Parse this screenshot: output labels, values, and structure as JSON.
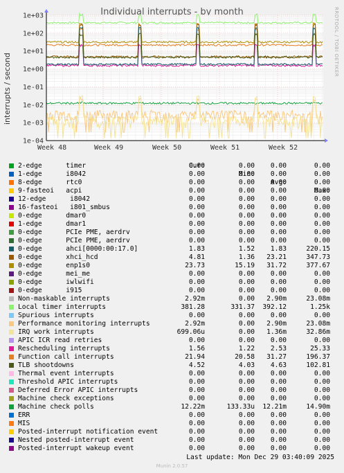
{
  "title": "Individual interrupts - by month",
  "side_label": "RRDTOOL / TOBI OETIKER",
  "chart_data": {
    "type": "line",
    "title": "Individual interrupts - by month",
    "ylabel": "interrupts / second",
    "yscale": "log",
    "ylim": [
      0.0001,
      1000
    ],
    "y_ticks": [
      "1e+03",
      "1e+02",
      "1e+01",
      "1e+00",
      "1e-01",
      "1e-02",
      "1e-03",
      "1e-04"
    ],
    "x_ticks": [
      "Week 48",
      "Week 49",
      "Week 50",
      "Week 51",
      "Week 52"
    ],
    "grid": true,
    "series": [
      {
        "name": "Local timer interrupts",
        "color": "#8ef26e",
        "base": 381.28,
        "spike": 1250
      },
      {
        "name": "Function call interrupts",
        "color": "#e67e22",
        "base": 21.94,
        "spike": 196.37
      },
      {
        "name": "0-edge enp1s0",
        "color": "#b08c00",
        "base": 31.72,
        "spike": 377.67
      },
      {
        "name": "Rescheduling interrupts",
        "color": "#e0189a",
        "base": 1.56,
        "spike": 25.33
      },
      {
        "name": "0-edge xhci_hcd",
        "color": "#9c5a00",
        "base": 4.81,
        "spike": 347.73
      },
      {
        "name": "0-edge ahci[0000:00:17.0]",
        "color": "#175e6c",
        "base": 1.83,
        "spike": 220.15
      },
      {
        "name": "TLB shootdowns",
        "color": "#4a5a18",
        "base": 4.52,
        "spike": 102.81
      },
      {
        "name": "Machine check polls",
        "color": "#10a03c",
        "base": 0.0122,
        "spike": 0.0149
      },
      {
        "name": "Performance monitoring interrupts",
        "color": "#f9c882",
        "base": 0.0029,
        "spike": 0.0231
      },
      {
        "name": "IRQ work interrupts",
        "color": "#f4e39a",
        "base": 0.0014,
        "spike": 0.0329
      }
    ]
  },
  "legend": {
    "headers": [
      "Cur:",
      "Min:",
      "Avg:",
      "Max:"
    ],
    "rows": [
      {
        "name": "2-edge      timer",
        "color": "#00a020",
        "cur": "0.00",
        "min": "0.00",
        "avg": "0.00",
        "max": "0.00"
      },
      {
        "name": "1-edge      i8042",
        "color": "#0060c0",
        "cur": "0.00",
        "min": "0.00",
        "avg": "0.00",
        "max": "0.00"
      },
      {
        "name": "8-edge      rtc0",
        "color": "#ff7000",
        "cur": "0.00",
        "min": "0.00",
        "avg": "0.00",
        "max": "0.00"
      },
      {
        "name": "9-fasteoi   acpi",
        "color": "#ffc800",
        "cur": "0.00",
        "min": "0.00",
        "avg": "0.00",
        "max": "0.00"
      },
      {
        "name": "12-edge      i8042",
        "color": "#200090",
        "cur": "0.00",
        "min": "0.00",
        "avg": "0.00",
        "max": "0.00"
      },
      {
        "name": "16-fasteoi   i801_smbus",
        "color": "#900090",
        "cur": "0.00",
        "min": "0.00",
        "avg": "0.00",
        "max": "0.00"
      },
      {
        "name": "0-edge      dmar0",
        "color": "#c8e600",
        "cur": "0.00",
        "min": "0.00",
        "avg": "0.00",
        "max": "0.00"
      },
      {
        "name": "1-edge      dmar1",
        "color": "#e00000",
        "cur": "0.00",
        "min": "0.00",
        "avg": "0.00",
        "max": "0.00"
      },
      {
        "name": "0-edge      PCIe PME, aerdrv",
        "color": "#409c40",
        "cur": "0.00",
        "min": "0.00",
        "avg": "0.00",
        "max": "0.00"
      },
      {
        "name": "0-edge      PCIe PME, aerdrv",
        "color": "#2e6e30",
        "cur": "0.00",
        "min": "0.00",
        "avg": "0.00",
        "max": "0.00"
      },
      {
        "name": "0-edge      ahci[0000:00:17.0]",
        "color": "#175e6c",
        "cur": "1.83",
        "min": "1.52",
        "avg": "1.83",
        "max": "220.15"
      },
      {
        "name": "0-edge      xhci_hcd",
        "color": "#9c5a00",
        "cur": "4.81",
        "min": "1.36",
        "avg": "23.21",
        "max": "347.73"
      },
      {
        "name": "0-edge      enp1s0",
        "color": "#b08c00",
        "cur": "23.73",
        "min": "15.19",
        "avg": "31.72",
        "max": "377.67"
      },
      {
        "name": "0-edge      mei_me",
        "color": "#5c1a80",
        "cur": "0.00",
        "min": "0.00",
        "avg": "0.00",
        "max": "0.00"
      },
      {
        "name": "0-edge      iwlwifi",
        "color": "#8ca000",
        "cur": "0.00",
        "min": "0.00",
        "avg": "0.00",
        "max": "0.00"
      },
      {
        "name": "0-edge      i915",
        "color": "#a01414",
        "cur": "0.00",
        "min": "0.00",
        "avg": "0.00",
        "max": "0.00"
      },
      {
        "name": "Non-maskable interrupts",
        "color": "#bcbcbc",
        "cur": "2.92m",
        "min": "0.00",
        "avg": "2.90m",
        "max": "23.08m"
      },
      {
        "name": "Local timer interrupts",
        "color": "#8ef26e",
        "cur": "381.28",
        "min": "331.37",
        "avg": "392.12",
        "max": "1.25k"
      },
      {
        "name": "Spurious interrupts",
        "color": "#7ec8f8",
        "cur": "0.00",
        "min": "0.00",
        "avg": "0.00",
        "max": "0.00"
      },
      {
        "name": "Performance monitoring interrupts",
        "color": "#f9c882",
        "cur": "2.92m",
        "min": "0.00",
        "avg": "2.90m",
        "max": "23.08m"
      },
      {
        "name": "IRQ work interrupts",
        "color": "#f4e39a",
        "cur": "699.06u",
        "min": "0.00",
        "avg": "1.36m",
        "max": "32.86m"
      },
      {
        "name": "APIC ICR read retries",
        "color": "#b890ee",
        "cur": "0.00",
        "min": "0.00",
        "avg": "0.00",
        "max": "0.00"
      },
      {
        "name": "Rescheduling interrupts",
        "color": "#e0189a",
        "cur": "1.56",
        "min": "1.22",
        "avg": "2.53",
        "max": "25.33"
      },
      {
        "name": "Function call interrupts",
        "color": "#e67e22",
        "cur": "21.94",
        "min": "20.58",
        "avg": "31.27",
        "max": "196.37"
      },
      {
        "name": "TLB shootdowns",
        "color": "#4a5a18",
        "cur": "4.52",
        "min": "4.03",
        "avg": "4.63",
        "max": "102.81"
      },
      {
        "name": "Thermal event interrupts",
        "color": "#ffb8e8",
        "cur": "0.00",
        "min": "0.00",
        "avg": "0.00",
        "max": "0.00"
      },
      {
        "name": "Threshold APIC interrupts",
        "color": "#20e6c0",
        "cur": "0.00",
        "min": "0.00",
        "avg": "0.00",
        "max": "0.00"
      },
      {
        "name": "Deferred Error APIC interrupts",
        "color": "#d45a8c",
        "cur": "0.00",
        "min": "0.00",
        "avg": "0.00",
        "max": "0.00"
      },
      {
        "name": "Machine check exceptions",
        "color": "#a0a020",
        "cur": "0.00",
        "min": "0.00",
        "avg": "0.00",
        "max": "0.00"
      },
      {
        "name": "Machine check polls",
        "color": "#10a03c",
        "cur": "12.22m",
        "min": "133.33u",
        "avg": "12.21m",
        "max": "14.90m"
      },
      {
        "name": "ERR",
        "color": "#0070d0",
        "cur": "0.00",
        "min": "0.00",
        "avg": "0.00",
        "max": "0.00"
      },
      {
        "name": "MIS",
        "color": "#ff7a14",
        "cur": "0.00",
        "min": "0.00",
        "avg": "0.00",
        "max": "0.00"
      },
      {
        "name": "Posted-interrupt notification event",
        "color": "#ffcc00",
        "cur": "0.00",
        "min": "0.00",
        "avg": "0.00",
        "max": "0.00"
      },
      {
        "name": "Nested posted-interrupt event",
        "color": "#1a0a90",
        "cur": "0.00",
        "min": "0.00",
        "avg": "0.00",
        "max": "0.00"
      },
      {
        "name": "Posted-interrupt wakeup event",
        "color": "#8a0a8a",
        "cur": "0.00",
        "min": "0.00",
        "avg": "0.00",
        "max": "0.00"
      }
    ]
  },
  "footer": {
    "last_update": "Last update: Mon Dec 29 03:40:09 2025",
    "munin": "Munin 2.0.57"
  }
}
